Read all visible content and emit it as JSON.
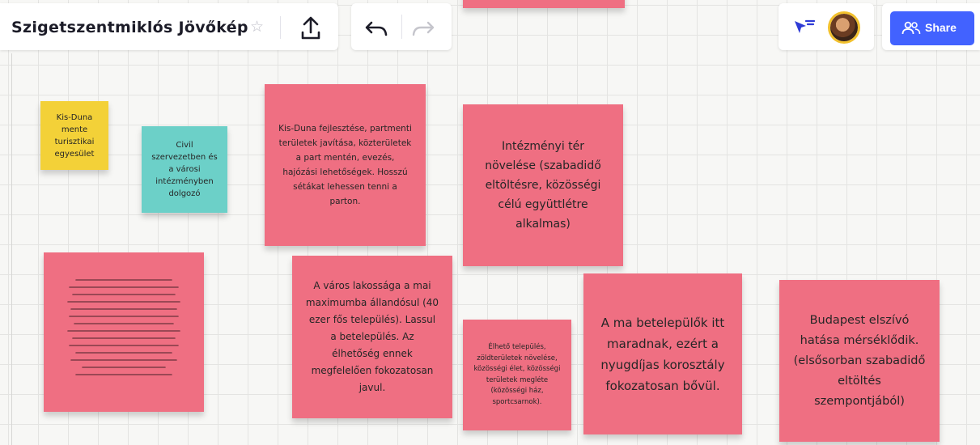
{
  "header": {
    "board_title": "Szigetszentmiklós Jövőkép",
    "share_label": "Share"
  },
  "icons": {
    "star": "star-icon",
    "upload": "upload-icon",
    "undo": "undo-icon",
    "redo": "redo-icon",
    "cursor": "cursor-arrow-icon",
    "share": "people-icon"
  },
  "colors": {
    "accent": "#4262ff",
    "note_pink": "#ef6f82",
    "note_yellow": "#f3d138",
    "note_teal": "#6cd0c8"
  },
  "notes": {
    "kis_duna_egyesulet": "Kis-Duna mente turisztikai egyesület",
    "civil_szervezet": "Civil szervezetben és a városi intézményben dolgozó",
    "kis_duna_fejlesztes": "Kis-Duna fejlesztése, partmenti területek javítása, közterületek a part mentén, evezés, hajózási lehetőségek. Hosszú sétákat lehessen tenni a parton.",
    "intezmenyi_ter": "Intézményi tér növelése (szabadidő eltöltésre, közösségi célú együttlétre alkalmas)",
    "varos_lakossaga": "A város lakossága a mai maximumba állandósul (40 ezer fős település). Lassul a betelepülés. Az élhetőség ennek megfelelően fokozatosan javul.",
    "elheto_telepules": "Élhető település, zöldterületek növelése, közösségi élet, közösségi területek megléte (közösségi ház, sportcsarnok).",
    "betelepulok": "A ma betelepülők itt maradnak, ezért a nyugdíjas korosztály fokozatosan bővül.",
    "budapest": "Budapest elszívó hatása mérséklődik. (elsősorban szabadidő eltöltés szempontjából)"
  }
}
